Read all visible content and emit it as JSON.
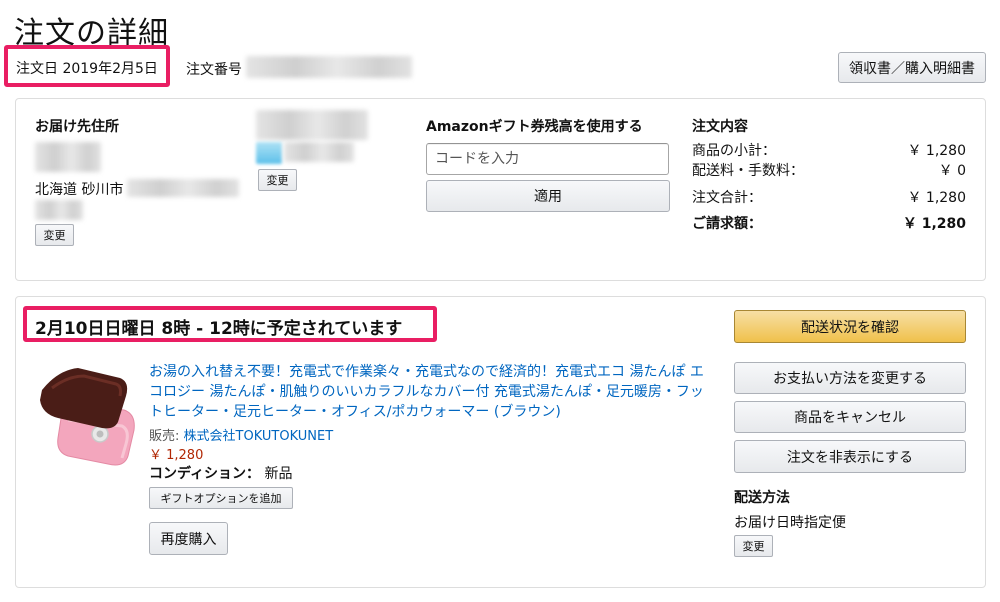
{
  "page": {
    "title": "注文の詳細",
    "order_date": "注文日 2019年2月5日",
    "order_number_label": "注文番号",
    "receipt_button": "領収書／購入明細書"
  },
  "shipping_address": {
    "heading": "お届け先住所",
    "address_line": "北海道 砂川市",
    "change_label": "変更"
  },
  "payment": {
    "change_label": "変更"
  },
  "gift_card": {
    "heading": "Amazonギフト券残高を使用する",
    "placeholder": "コードを入力",
    "apply_label": "適用"
  },
  "summary": {
    "heading": "注文内容",
    "subtotal_label": "商品の小計：",
    "subtotal_value": "￥ 1,280",
    "shipping_label": "配送料・手数料：",
    "shipping_value": "￥ 0",
    "total_label": "注文合計：",
    "total_value": "￥ 1,280",
    "billed_label": "ご請求額：",
    "billed_value": "￥ 1,280"
  },
  "shipment": {
    "delivery_message": "2月10日日曜日 8時 - 12時に予定されています",
    "item": {
      "title": "お湯の入れ替え不要！充電式で作業楽々・充電式なので経済的！充電式エコ 湯たんぽ エコロジー 湯たんぽ・肌触りのいいカラフルなカバー付 充電式湯たんぽ・足元暖房・フットヒーター・足元ヒーター・オフィス/ポカウォーマー (ブラウン)",
      "seller_label": "販売:",
      "seller_name": "株式会社TOKUTOKUNET",
      "price": "￥ 1,280",
      "condition_label": "コンディション：",
      "condition_value": "新品",
      "gift_option_label": "ギフトオプションを追加",
      "buy_again_label": "再度購入"
    },
    "actions": {
      "track": "配送状況を確認",
      "change_payment": "お支払い方法を変更する",
      "cancel": "商品をキャンセル",
      "hide": "注文を非表示にする"
    },
    "delivery_method_heading": "配送方法",
    "delivery_method_value": "お届け日時指定便",
    "delivery_method_change": "変更"
  },
  "colors": {
    "highlight": "#e91e63",
    "link": "#0066c0",
    "price": "#b12704",
    "primary_button": "#f0c14b"
  }
}
